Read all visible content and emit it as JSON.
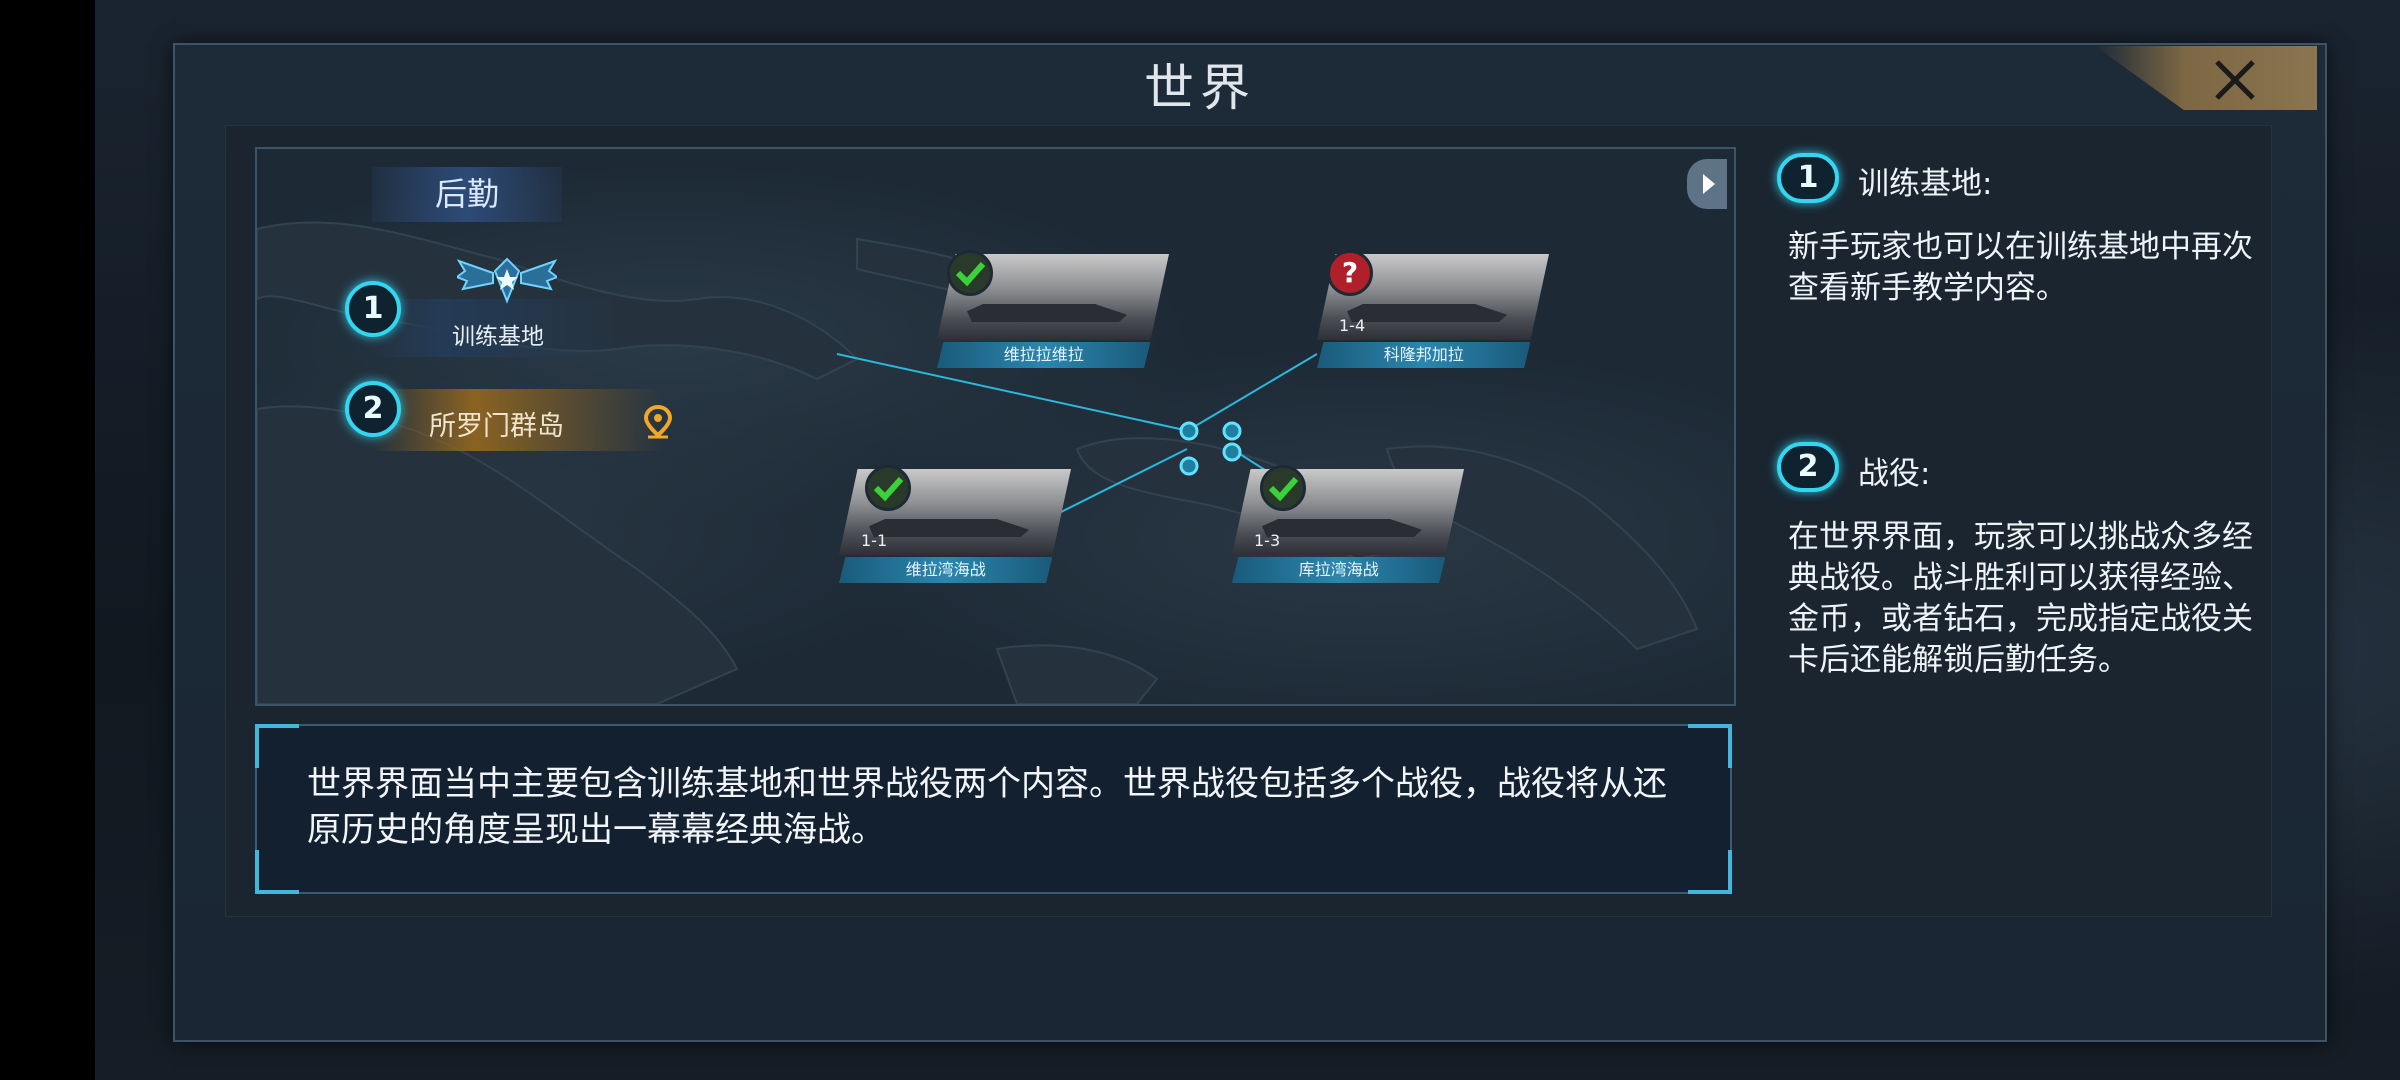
{
  "title": "世界",
  "close_icon": "close-x-icon",
  "map": {
    "logistics_label": "后勤",
    "training": {
      "number": "1",
      "label": "训练基地"
    },
    "solomon": {
      "number": "2",
      "label": "所罗门群岛"
    },
    "battles": [
      {
        "name": "维拉拉维拉",
        "stage": "",
        "status": "completed"
      },
      {
        "name": "科隆邦加拉",
        "stage": "1-4",
        "status": "unknown"
      },
      {
        "name": "维拉湾海战",
        "stage": "1-1",
        "status": "completed"
      },
      {
        "name": "库拉湾海战",
        "stage": "1-3",
        "status": "completed"
      }
    ],
    "unknown_mark": "?"
  },
  "description": "世界界面当中主要包含训练基地和世界战役两个内容。世界战役包括多个战役，战役将从还原历史的角度呈现出一幕幕经典海战。",
  "side": {
    "item1": {
      "number": "1",
      "heading": "训练基地:",
      "body": "新手玩家也可以在训练基地中再次查看新手教学内容。"
    },
    "item2": {
      "number": "2",
      "heading": "战役:",
      "body": "在世界界面，玩家可以挑战众多经典战役。战斗胜利可以获得经验、金币，或者钻石，完成指定战役关卡后还能解锁后勤任务。"
    }
  },
  "colors": {
    "accent": "#33d6f0",
    "gold": "#8a6322",
    "check": "#3ad13a"
  }
}
